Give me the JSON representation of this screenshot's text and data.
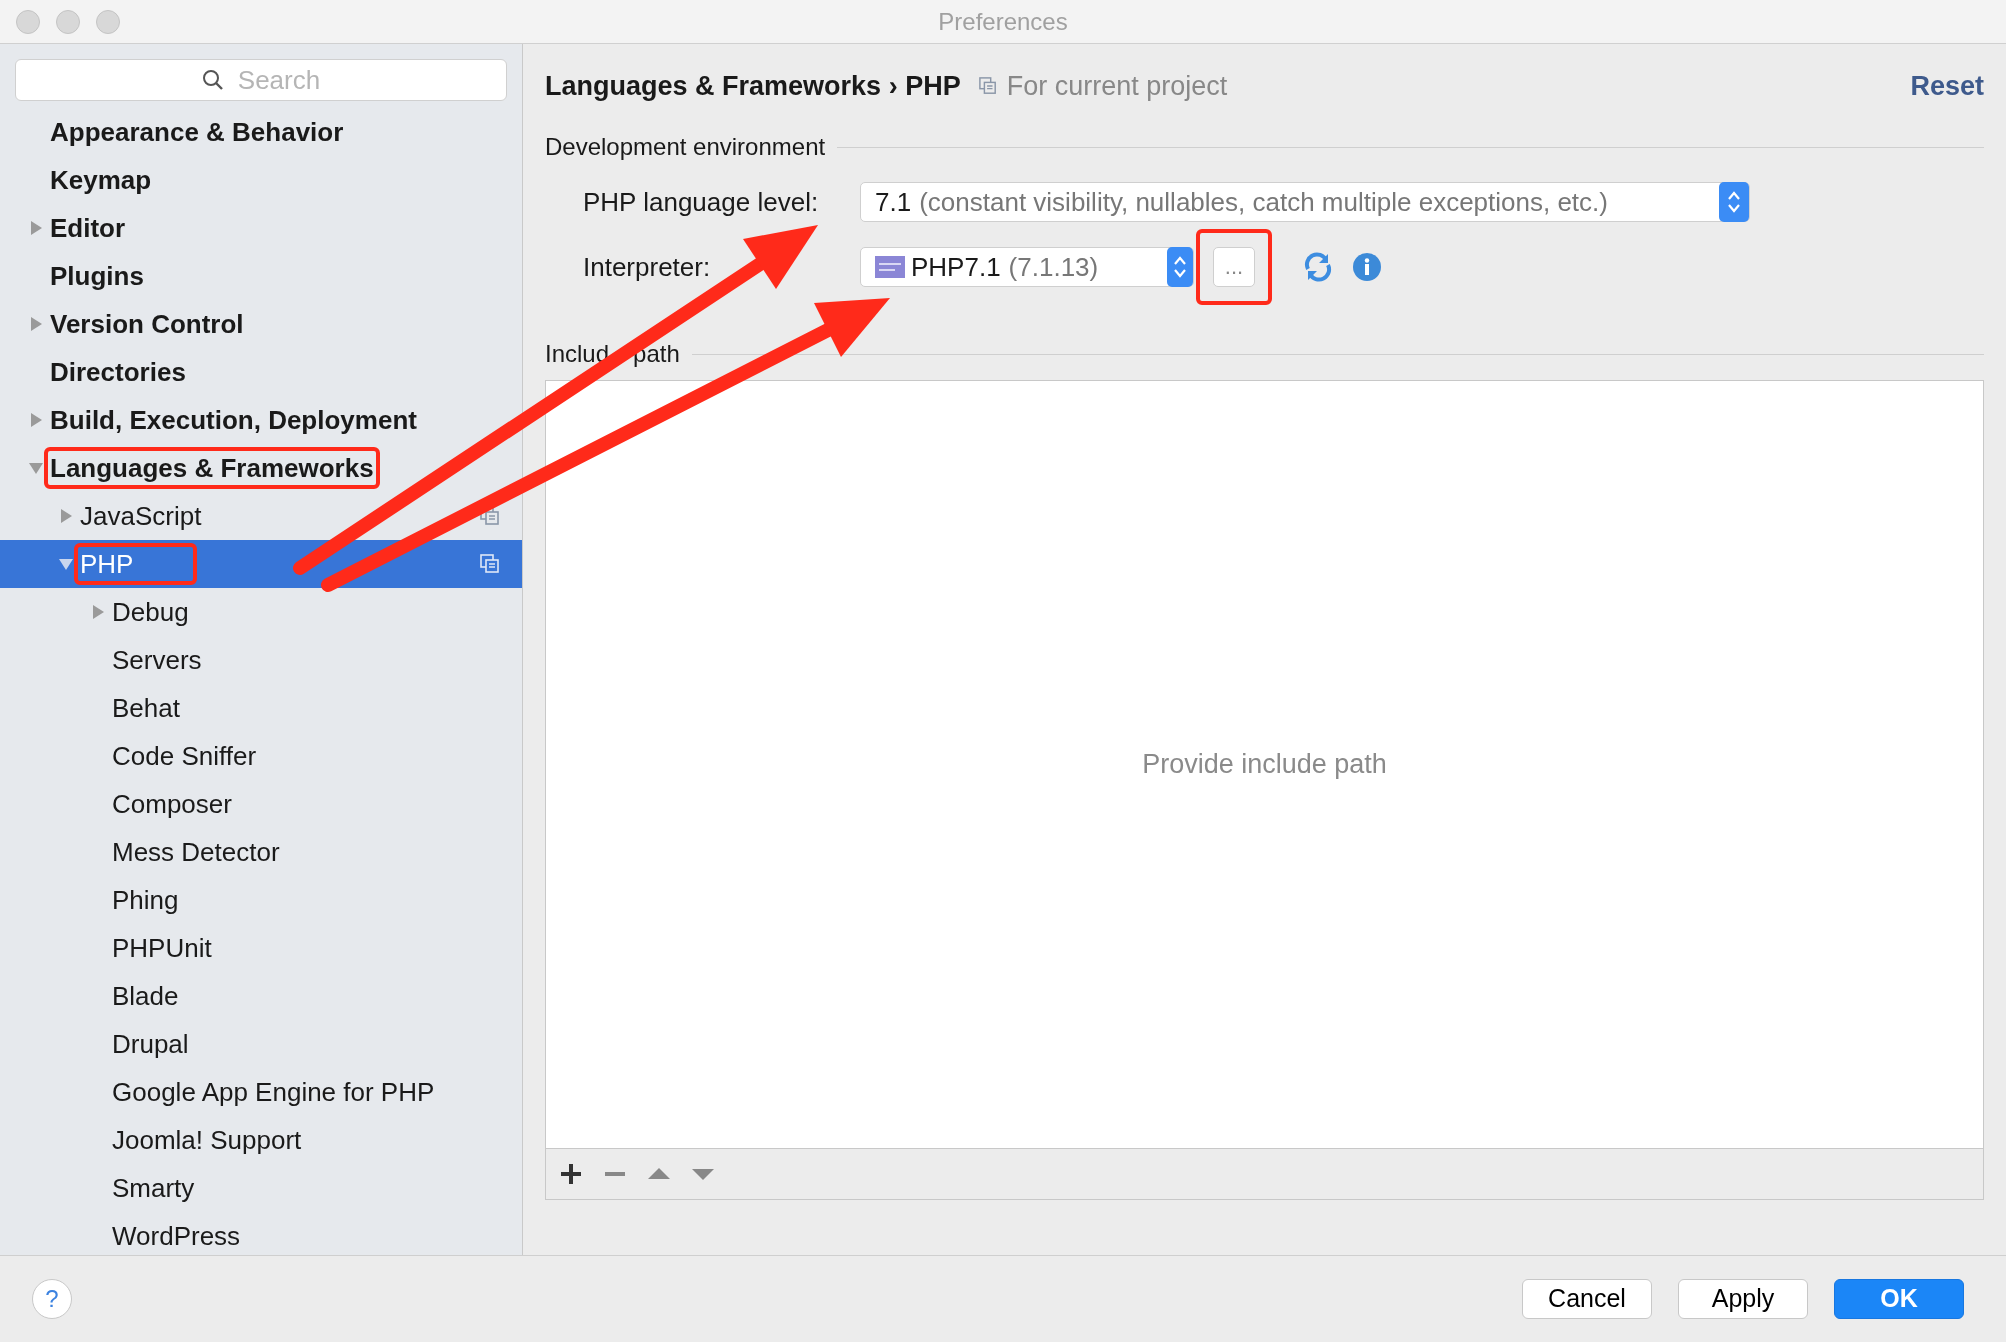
{
  "window": {
    "title": "Preferences"
  },
  "search": {
    "placeholder": "Search"
  },
  "sidebar": {
    "items": [
      {
        "label": "Appearance & Behavior",
        "selected": false
      },
      {
        "label": "Keymap",
        "selected": false
      },
      {
        "label": "Editor",
        "selected": false,
        "expanded": false
      },
      {
        "label": "Plugins",
        "selected": false
      },
      {
        "label": "Version Control",
        "selected": false,
        "expanded": false
      },
      {
        "label": "Directories",
        "selected": false
      },
      {
        "label": "Build, Execution, Deployment",
        "selected": false,
        "expanded": false
      },
      {
        "label": "Languages & Frameworks",
        "selected": false,
        "expanded": true,
        "outlined": true,
        "children": [
          {
            "label": "JavaScript",
            "selected": false,
            "expanded": false,
            "project_scoped": true
          },
          {
            "label": "PHP",
            "selected": true,
            "expanded": true,
            "outlined": true,
            "project_scoped": true,
            "children": [
              {
                "label": "Debug",
                "selected": false,
                "expanded": false
              },
              {
                "label": "Servers",
                "selected": false
              },
              {
                "label": "Behat",
                "selected": false
              },
              {
                "label": "Code Sniffer",
                "selected": false
              },
              {
                "label": "Composer",
                "selected": false
              },
              {
                "label": "Mess Detector",
                "selected": false
              },
              {
                "label": "Phing",
                "selected": false
              },
              {
                "label": "PHPUnit",
                "selected": false
              },
              {
                "label": "Blade",
                "selected": false
              },
              {
                "label": "Drupal",
                "selected": false
              },
              {
                "label": "Google App Engine for PHP",
                "selected": false
              },
              {
                "label": "Joomla! Support",
                "selected": false
              },
              {
                "label": "Smarty",
                "selected": false
              },
              {
                "label": "WordPress",
                "selected": false
              }
            ]
          }
        ]
      }
    ]
  },
  "breadcrumb": {
    "parent": "Languages & Frameworks",
    "separator": "›",
    "current": "PHP",
    "scope": "For current project"
  },
  "reset_link": "Reset",
  "development_environment": {
    "title": "Development environment",
    "language_level": {
      "label": "PHP language level:",
      "value": "7.1",
      "description": "(constant visibility, nullables, catch multiple exceptions, etc.)"
    },
    "interpreter": {
      "label": "Interpreter:",
      "value": "PHP7.1",
      "version": "(7.1.13)",
      "browse_button": {
        "label": "...",
        "outlined": true
      }
    }
  },
  "include_path": {
    "title_parts": [
      "Includ",
      "path"
    ],
    "placeholder": "Provide include path"
  },
  "help_button": "?",
  "buttons": [
    {
      "label": "Cancel",
      "kind": "default"
    },
    {
      "label": "Apply",
      "kind": "default"
    },
    {
      "label": "OK",
      "kind": "primary"
    }
  ]
}
